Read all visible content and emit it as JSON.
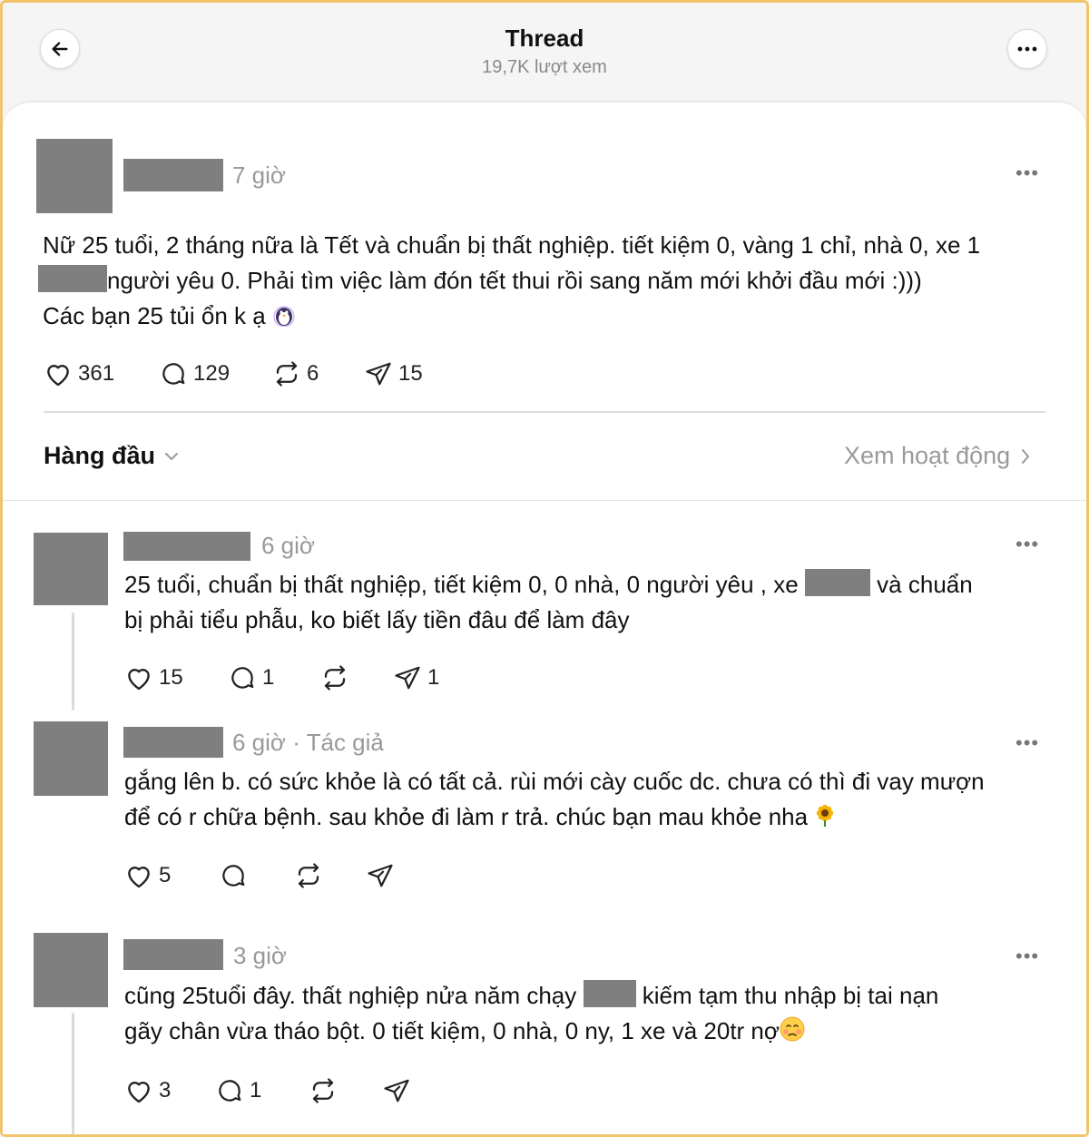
{
  "header": {
    "title": "Thread",
    "views": "19,7K lượt xem",
    "back_icon": "arrow-left-icon",
    "more_icon": "more-horizontal-icon"
  },
  "post": {
    "time": "7 giờ",
    "line1": "Nữ 25 tuổi, 2 tháng nữa là Tết và chuẩn bị thất nghiệp. tiết kiệm 0, vàng 1 chỉ, nhà 0, xe 1",
    "line2": "người yêu 0. Phải tìm việc làm đón tết thui rồi sang năm mới khởi đầu mới :)))",
    "line3": "Các bạn 25 tủi ổn k ạ",
    "likes": "361",
    "comments": "129",
    "reposts": "6",
    "shares": "15"
  },
  "filter": {
    "label": "Hàng đầu",
    "activity_label": "Xem hoạt động"
  },
  "replies": [
    {
      "time": "6 giờ",
      "text_a": "25 tuổi, chuẩn bị thất nghiệp, tiết kiệm 0, 0 nhà, 0 người yêu , xe",
      "text_b": "và chuẩn",
      "text_c": "bị phải tiểu phẫu, ko biết lấy tiền đâu để làm đây",
      "likes": "15",
      "comments": "1",
      "shares": "1"
    },
    {
      "time": "6 giờ · Tác giả",
      "text_a": "gắng lên b. có sức khỏe là có tất cả. rùi mới cày cuốc dc. chưa có thì đi vay mượn",
      "text_b": "để có r chữa bệnh. sau khỏe đi làm r trả. chúc bạn mau khỏe nha",
      "likes": "5"
    },
    {
      "time": "3 giờ",
      "text_a": "cũng 25tuổi đây. thất nghiệp nửa năm chạy",
      "text_b": "kiếm tạm thu nhập bị tai nạn",
      "text_c": "gãy chân vừa tháo bột. 0 tiết kiệm, 0 nhà, 0 ny, 1 xe và 20tr nợ",
      "likes": "3",
      "comments": "1"
    }
  ],
  "colors": {
    "frame": "#f2c46a",
    "redaction": "#7f7f7f",
    "muted": "#999999"
  }
}
